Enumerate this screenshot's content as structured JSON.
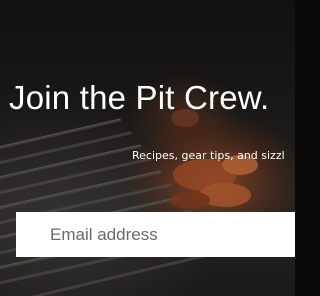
{
  "signup": {
    "headline": "Join the Pit Crew.",
    "subline": "Recipes, gear tips, and sizzl",
    "email_placeholder": "Email address"
  },
  "background": {
    "description_icon": "grill-grate-photo",
    "accent_color": "#c85f2d"
  }
}
